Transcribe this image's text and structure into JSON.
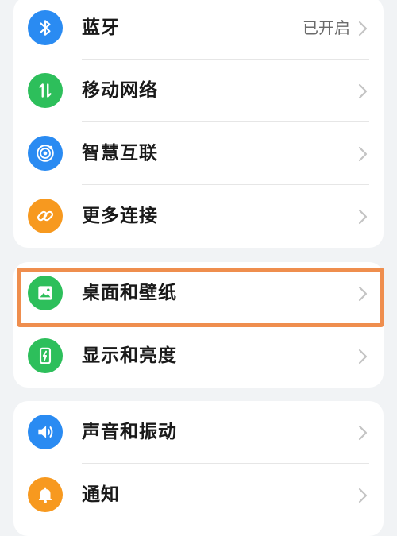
{
  "colors": {
    "background": "#f1f3f5",
    "card": "#ffffff",
    "highlight_border": "#ef8e4e",
    "blue": "#2a8bf2",
    "green": "#2dbf5b",
    "orange": "#f7991f"
  },
  "groups": [
    {
      "items": [
        {
          "label": "蓝牙",
          "value": "已开启",
          "icon": "bluetooth-icon"
        },
        {
          "label": "移动网络",
          "icon": "mobile-data-icon"
        },
        {
          "label": "智慧互联",
          "icon": "smart-connect-icon"
        },
        {
          "label": "更多连接",
          "icon": "link-icon"
        }
      ]
    },
    {
      "items": [
        {
          "label": "桌面和壁纸",
          "icon": "wallpaper-icon",
          "highlighted": true
        },
        {
          "label": "显示和亮度",
          "icon": "display-brightness-icon"
        }
      ]
    },
    {
      "items": [
        {
          "label": "声音和振动",
          "icon": "sound-icon"
        },
        {
          "label": "通知",
          "icon": "notification-bell-icon"
        }
      ]
    }
  ]
}
